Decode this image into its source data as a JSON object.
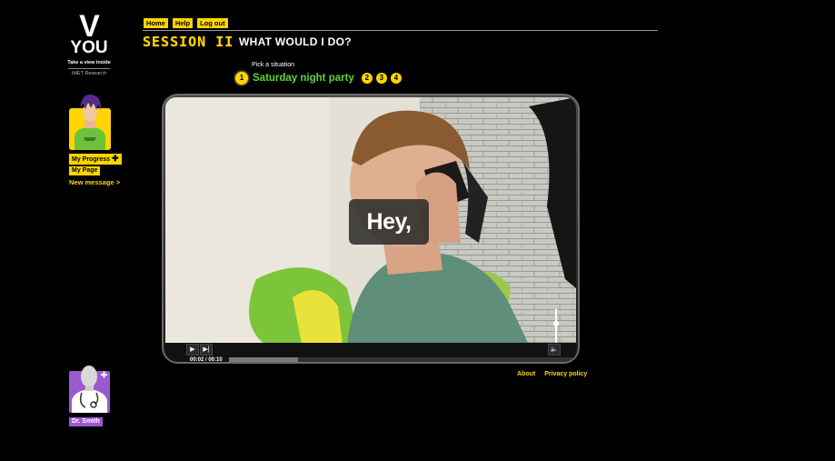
{
  "logo": {
    "mark": "V",
    "word": "YOU",
    "tagline": "Take a view inside",
    "org": "iMET Research"
  },
  "nav": [
    {
      "label": "Home"
    },
    {
      "label": "Help"
    },
    {
      "label": "Log out"
    }
  ],
  "header": {
    "session_label": "SESSION II",
    "title": "WHAT WOULD I DO?"
  },
  "situations": {
    "label": "Pick a situation",
    "current": {
      "number": "1",
      "title": "Saturday night party"
    },
    "others": [
      "2",
      "3",
      "4"
    ]
  },
  "user": {
    "progress_label": "My Progress",
    "progress_icon": "plus-icon",
    "page_label": "My Page",
    "message_label": "New message >"
  },
  "doctor": {
    "name": "Dr. Smith",
    "badge_icon": "plus-icon"
  },
  "video": {
    "caption": "Hey,",
    "time_readout": "00:02 / 00:10",
    "progress_fraction": 0.2
  },
  "footer": [
    {
      "label": "About"
    },
    {
      "label": "Privacy policy"
    }
  ],
  "colors": {
    "accent": "#ffd400",
    "situation_text": "#5cd63a",
    "doctor_badge": "#9b59d0",
    "background": "#000000"
  }
}
